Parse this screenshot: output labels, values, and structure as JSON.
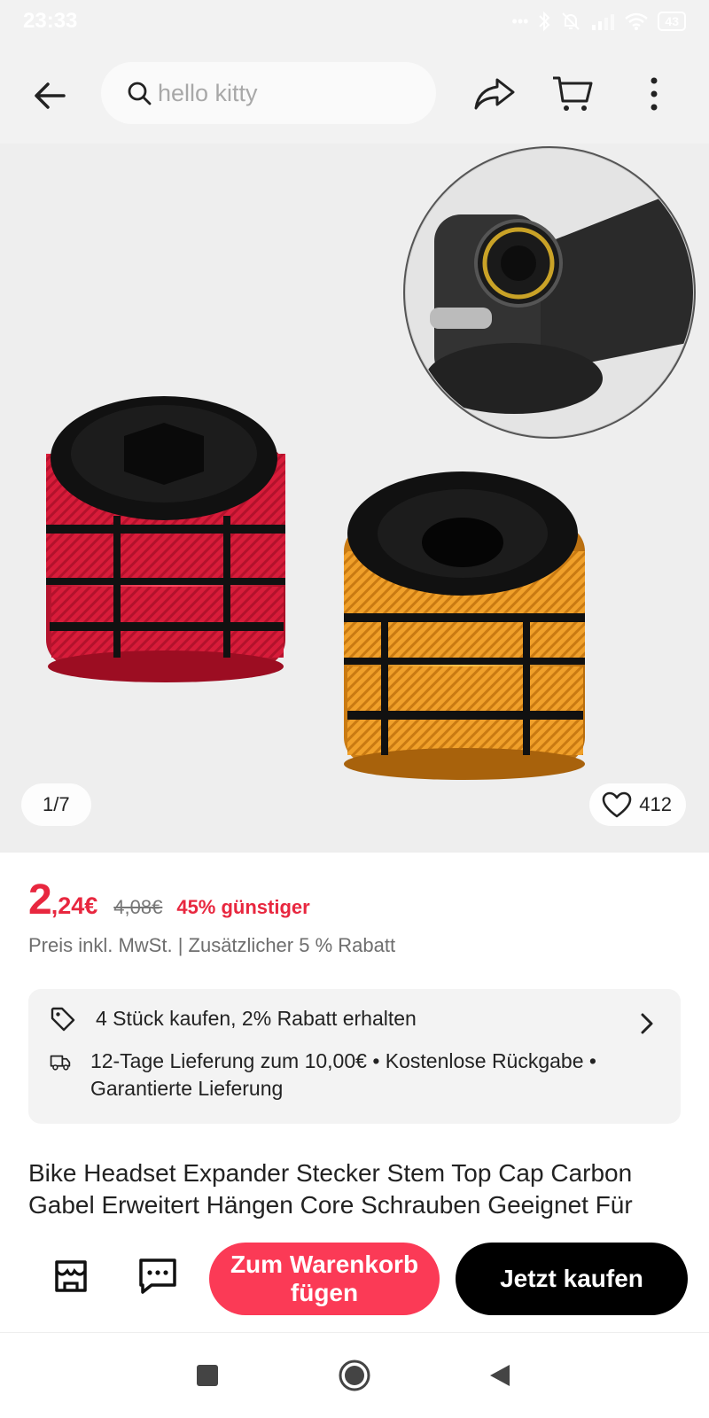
{
  "status_bar": {
    "time": "23:33",
    "battery": "43"
  },
  "search": {
    "placeholder": "hello kitty"
  },
  "gallery": {
    "page_indicator": "1/7",
    "like_count": "412"
  },
  "price": {
    "main_integer": "2",
    "main_rest": ",24€",
    "original": "4,08€",
    "discount": "45% günstiger",
    "note": "Preis inkl. MwSt. | Zusätzlicher 5 % Rabatt"
  },
  "info": {
    "bulk_offer": "4 Stück kaufen, 2% Rabatt erhalten",
    "delivery": "12-Tage Lieferung zum 10,00€ • Kostenlose Rückgabe • Garantierte Lieferung"
  },
  "product": {
    "title": "Bike Headset Expander Stecker Stem Top Cap Carbon Gabel Erweitert Hängen Core Schrauben Geeignet Für"
  },
  "actions": {
    "add_to_cart": "Zum Warenkorb fügen",
    "buy_now": "Jetzt kaufen"
  },
  "colors": {
    "accent": "#e8273f",
    "cart_button": "#fb3a56",
    "buy_button": "#000000"
  },
  "icons": [
    "back-arrow-icon",
    "search-icon",
    "share-icon",
    "cart-icon",
    "more-vert-icon",
    "heart-icon",
    "tag-icon",
    "truck-icon",
    "chevron-right-icon",
    "store-icon",
    "chat-icon",
    "nav-square-icon",
    "nav-home-icon",
    "nav-back-icon"
  ]
}
